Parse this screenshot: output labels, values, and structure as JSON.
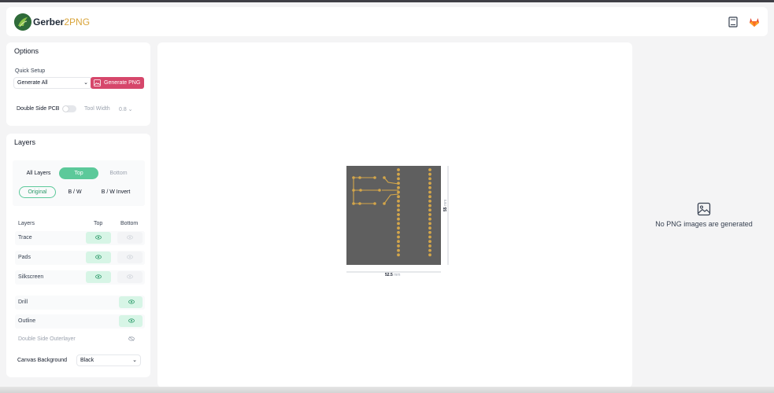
{
  "app": {
    "name": "Gerber",
    "name_accent": "2PNG"
  },
  "header": {
    "icons": [
      "book-icon",
      "gitlab-icon"
    ]
  },
  "options": {
    "title": "Options",
    "quick_setup_label": "Quick Setup",
    "quick_setup_value": "Generate All",
    "generate_label": "Generate PNG",
    "double_side_label": "Double Side PCB",
    "double_side_on": false,
    "tool_width_label": "Tool Width",
    "tool_width_value": "0.8"
  },
  "layers": {
    "title": "Layers",
    "side_tabs": [
      "All Layers",
      "Top",
      "Bottom"
    ],
    "active_side": "Top",
    "mode_tabs": [
      "Original",
      "B / W",
      "B / W Invert"
    ],
    "active_mode": "Original",
    "table_headers": {
      "name": "Layers",
      "top": "Top",
      "bottom": "Bottom"
    },
    "rows": [
      {
        "name": "Trace",
        "top": true,
        "bottom": false
      },
      {
        "name": "Pads",
        "top": true,
        "bottom": false
      },
      {
        "name": "Silkscreen",
        "top": true,
        "bottom": false
      }
    ],
    "single_rows": [
      {
        "name": "Drill",
        "visible": true
      },
      {
        "name": "Outline",
        "visible": true
      },
      {
        "name": "Double Side Outerlayer",
        "visible": false
      }
    ],
    "canvas_bg_label": "Canvas Background",
    "canvas_bg_value": "Black"
  },
  "preview": {
    "width_value": "52.5",
    "width_unit": "mm",
    "height_value": "55",
    "height_unit": "mm"
  },
  "output": {
    "empty_message": "No PNG images are generated"
  },
  "colors": {
    "accent_green": "#5cc99a",
    "primary_pink": "#d6476b",
    "board": "#5f5f5f",
    "copper": "#d4a64a"
  }
}
